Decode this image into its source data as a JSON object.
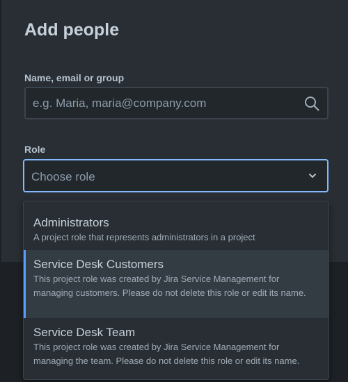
{
  "dialog": {
    "title": "Add people",
    "name_field": {
      "label": "Name, email or group",
      "placeholder": "e.g. Maria, maria@company.com",
      "value": ""
    },
    "role_field": {
      "label": "Role",
      "placeholder": "Choose role",
      "state": "open"
    }
  },
  "role_options": [
    {
      "title": "Administrators",
      "description": "A project role that represents administrators in a project",
      "highlighted": false
    },
    {
      "title": "Service Desk Customers",
      "description": "This project role was created by Jira Service Management for managing customers. Please do not delete this role or edit its name.",
      "highlighted": true
    },
    {
      "title": "Service Desk Team",
      "description": "This project role was created by Jira Service Management for managing the team. Please do not delete this role or edit its name.",
      "highlighted": false
    }
  ],
  "icons": {
    "search": "search-icon",
    "select_caret": "chevron-down-icon"
  },
  "colors": {
    "background": "#1d2125",
    "dialog": "#282e33",
    "focus_border": "#85b8ff",
    "highlight_bar": "#579dff",
    "highlight_bg": "#333b43"
  }
}
